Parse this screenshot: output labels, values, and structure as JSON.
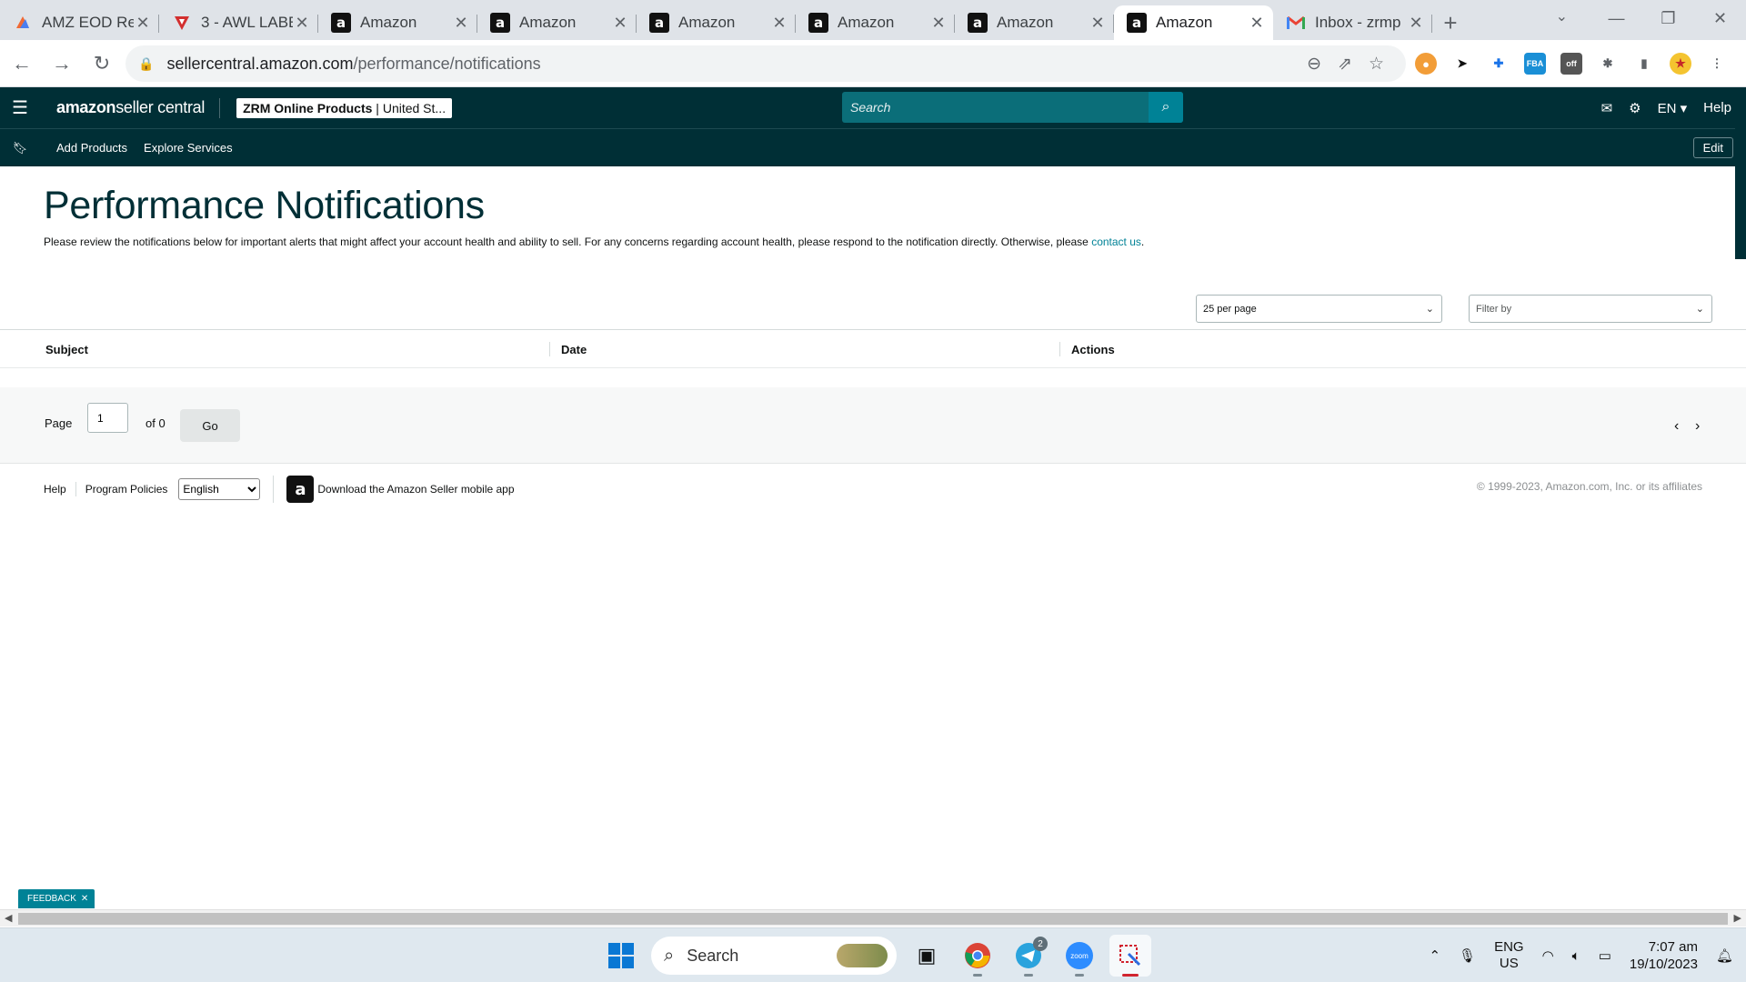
{
  "browser": {
    "tabs": [
      {
        "title": "AMZ EOD Re",
        "icon": "asana-icon",
        "active": false
      },
      {
        "title": "3 - AWL LABE",
        "icon": "awl-icon",
        "active": false
      },
      {
        "title": "Amazon",
        "icon": "amazon-icon",
        "active": false
      },
      {
        "title": "Amazon",
        "icon": "amazon-icon",
        "active": false
      },
      {
        "title": "Amazon",
        "icon": "amazon-icon",
        "active": false
      },
      {
        "title": "Amazon",
        "icon": "amazon-icon",
        "active": false
      },
      {
        "title": "Amazon",
        "icon": "amazon-icon",
        "active": false
      },
      {
        "title": "Amazon",
        "icon": "amazon-icon",
        "active": true
      },
      {
        "title": "Inbox - zrmp",
        "icon": "gmail-icon",
        "active": false
      }
    ],
    "url_host": "sellercentral.amazon.com",
    "url_path": "/performance/notifications",
    "ext_badge": "off"
  },
  "header": {
    "logo_bold": "amazon",
    "logo_rest": " seller central",
    "account_name": "ZRM Online Products",
    "account_region": "United St...",
    "search_placeholder": "Search",
    "lang": "EN",
    "help": "Help"
  },
  "subnav": {
    "links": [
      "Add Products",
      "Explore Services"
    ],
    "edit": "Edit"
  },
  "page": {
    "title": "Performance Notifications",
    "intro": "Please review the notifications below for important alerts that might affect your account health and ability to sell. For any concerns regarding account health, please respond to the notification directly. Otherwise, please",
    "contact_link": "contact us",
    "per_page": "25 per page",
    "filter": "Filter by",
    "columns": [
      "Subject",
      "Date",
      "Actions"
    ],
    "pager": {
      "page_label": "Page",
      "page_value": "1",
      "of_label": "of 0",
      "go": "Go"
    }
  },
  "footer": {
    "help": "Help",
    "policies": "Program Policies",
    "language": "English",
    "app_text": "Download the Amazon Seller mobile app",
    "copyright": "© 1999-2023, Amazon.com, Inc. or its affiliates"
  },
  "feedback": "FEEDBACK",
  "taskbar": {
    "search": "Search",
    "telegram_badge": "2",
    "zoom_label": "zoom",
    "lang_top": "ENG",
    "lang_bottom": "US",
    "time": "7:07 am",
    "date": "19/10/2023"
  },
  "colors": {
    "header": "#002f36",
    "accent": "#008296",
    "search_bg": "#0b6e79"
  }
}
